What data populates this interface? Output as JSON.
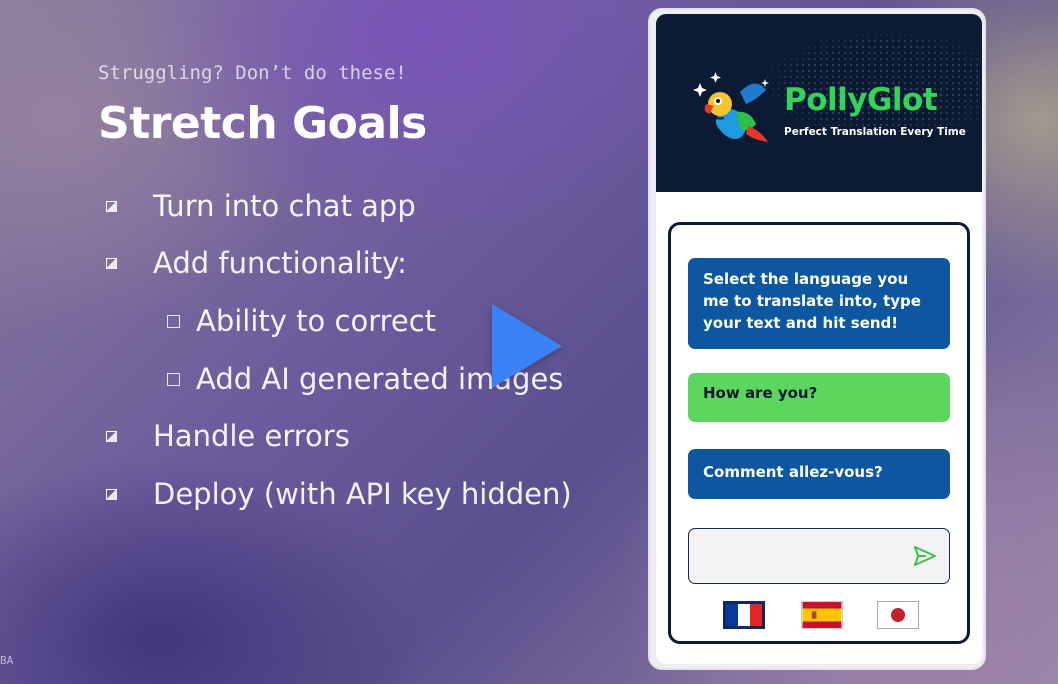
{
  "slide": {
    "subtitle": "Struggling? Don’t do these!",
    "title": "Stretch Goals",
    "items": [
      {
        "text": "Turn into chat app",
        "level": 1
      },
      {
        "text": "Add functionality:",
        "level": 1
      },
      {
        "text": "Ability to correct",
        "level": 2
      },
      {
        "text": "Add AI generated images",
        "level": 2
      },
      {
        "text": "Handle errors",
        "level": 1
      },
      {
        "text": "Deploy (with API key hidden)",
        "level": 1
      }
    ],
    "corner_text": "BA"
  },
  "video": {
    "play_icon": "play-icon",
    "accent": "#3b82f6"
  },
  "app": {
    "brand": "PollyGlot",
    "tagline": "Perfect Translation Every Time",
    "messages": [
      {
        "text": "Select the language you me to translate into, type your text and hit send!",
        "role": "system"
      },
      {
        "text": "How are you?",
        "role": "user"
      },
      {
        "text": "Comment allez-vous?",
        "role": "translation"
      }
    ],
    "input": {
      "value": "",
      "placeholder": ""
    },
    "send_icon": "send-icon",
    "flags": [
      "french-flag",
      "spanish-flag",
      "japanese-flag"
    ],
    "colors": {
      "brand_green": "#33d35c",
      "header_bg": "#0d1a33",
      "bubble_blue": "#0d56a0",
      "bubble_green": "#5cd65f"
    }
  }
}
